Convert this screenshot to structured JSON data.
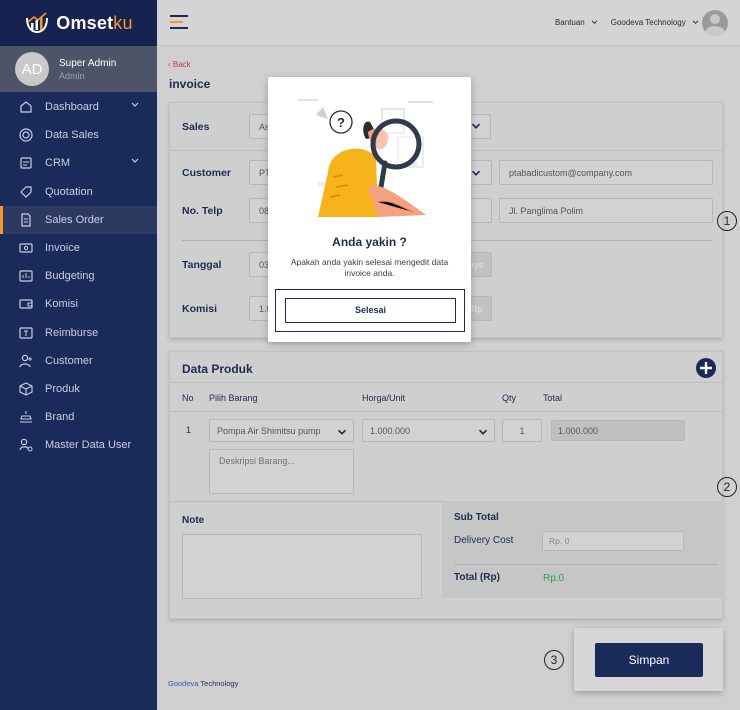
{
  "app": {
    "name_main": "Omset",
    "name_accent": "ku"
  },
  "profile": {
    "initials": "AD",
    "name": "Super Admin",
    "role": "Admin"
  },
  "sidebar": {
    "items": [
      {
        "label": "Dashboard",
        "icon": "home-icon",
        "has_chevron": true
      },
      {
        "label": "Data Sales",
        "icon": "target-icon",
        "has_chevron": false
      },
      {
        "label": "CRM",
        "icon": "crm-icon",
        "has_chevron": true
      },
      {
        "label": "Quotation",
        "icon": "tag-icon",
        "has_chevron": false
      },
      {
        "label": "Sales Order",
        "icon": "document-icon",
        "has_chevron": false,
        "active": true
      },
      {
        "label": "Invoice",
        "icon": "invoice-icon",
        "has_chevron": false
      },
      {
        "label": "Budgeting",
        "icon": "budget-icon",
        "has_chevron": false
      },
      {
        "label": "Komisi",
        "icon": "wallet-icon",
        "has_chevron": false
      },
      {
        "label": "Reimburse",
        "icon": "reimburse-icon",
        "has_chevron": false
      },
      {
        "label": "Customer",
        "icon": "customer-icon",
        "has_chevron": false
      },
      {
        "label": "Produk",
        "icon": "box-icon",
        "has_chevron": false
      },
      {
        "label": "Brand",
        "icon": "brand-icon",
        "has_chevron": false
      },
      {
        "label": "Master Data User",
        "icon": "user-settings-icon",
        "has_chevron": false
      }
    ]
  },
  "header": {
    "help": "Bantuan",
    "company": "Goodeva Technology"
  },
  "page": {
    "back": "Back",
    "title": "invoice"
  },
  "form": {
    "sales_label": "Sales",
    "sales_value": "As",
    "customer_label": "Customer",
    "customer_value": "PT",
    "email": "ptabadicustom@company.com",
    "phone_label": "No. Telp",
    "phone_value": "08",
    "address": "Jl. Panglima Polim",
    "date_label": "Tanggal",
    "date_value": "03/",
    "days_suffix": "ays",
    "commission_label": "Komisi",
    "commission_value": "1.0",
    "rp_suffix": "Rp"
  },
  "products": {
    "title": "Data Produk",
    "columns": [
      "No",
      "Pilih Barang",
      "Horga/Unit",
      "Qty",
      "Total"
    ],
    "rows": [
      {
        "no": "1",
        "item": "Pompa Air Shimitsu pump",
        "price": "1.000.000",
        "qty": "1",
        "total": "1.000.000",
        "description_placeholder": "Deskripsi Barang..."
      }
    ]
  },
  "summary": {
    "note_label": "Note",
    "subtotal_label": "Sub Total",
    "delivery_label": "Delivery Cost",
    "delivery_placeholder": "Rp. 0",
    "total_label": "Total (Rp)",
    "total_value": "Rp.0"
  },
  "markers": [
    "1",
    "2",
    "3"
  ],
  "modal": {
    "title": "Anda yakin ?",
    "text": "Apakah anda yakin selesai mengedit data invoice anda.",
    "button": "Selesai"
  },
  "actions": {
    "save": "Simpan"
  },
  "footer": {
    "brand": "Goodeva",
    "suffix": " Technology"
  },
  "colors": {
    "navy": "#1a2a5a",
    "accent": "#f39a2b",
    "green": "#2e9e4a",
    "back_red": "#c43b3b"
  }
}
